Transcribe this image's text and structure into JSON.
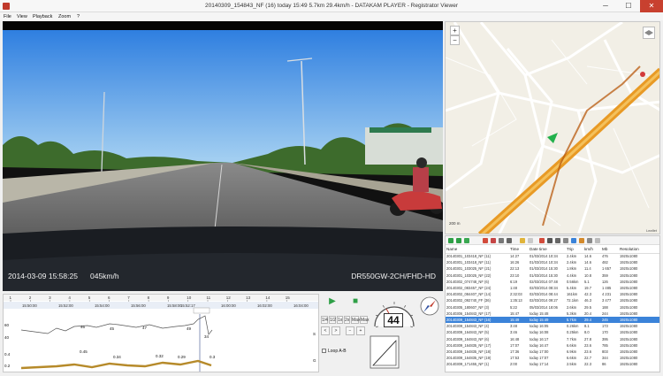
{
  "window": {
    "title": "20140309_154843_NF (16)   today 15:49   5.7km   29.4km/h  -  DATAKAM PLAYER - Registrator Viewer",
    "minimize": "─",
    "maximize": "☐",
    "close": "✕"
  },
  "menu": [
    "File",
    "View",
    "Playback",
    "Zoom",
    "?"
  ],
  "video": {
    "timestamp": "2014-03-09  15:58:25",
    "speed": "045km/h",
    "model": "DR550GW-2CH/FHD-HD"
  },
  "map": {
    "zoom_in": "+",
    "zoom_out": "−",
    "scale": "200 m",
    "attribution": "Leaflet"
  },
  "timeline": {
    "ruler_numbers": [
      "1",
      "2",
      "3",
      "4",
      "5",
      "6",
      "7",
      "8",
      "9",
      "10",
      "11",
      "12",
      "13",
      "14",
      "15"
    ],
    "time_labels": [
      "15:50:00",
      "15:52:00",
      "15:54:00",
      "15:56:00",
      "15:58:00",
      "15:52:17",
      "16:00:00",
      "16:02:00",
      "16:04:00"
    ],
    "speed_labels": [
      "46",
      "45",
      "47",
      "49",
      "34"
    ],
    "axis_top": [
      "60",
      "40"
    ],
    "axis_bottom": [
      "0.4",
      "0.2"
    ],
    "accel_labels": [
      "0.45",
      "0.34",
      "0.32",
      "0.29",
      "0.3"
    ],
    "side_labels": [
      "S",
      "G"
    ]
  },
  "controls": {
    "play": "▶",
    "stop": "■",
    "speeds": [
      "1/4",
      "1/2",
      "1x",
      "2x",
      "Max",
      "Max"
    ],
    "prev": "<",
    "next": ">",
    "zoom_minus": "−",
    "zoom_plus": "+",
    "loop_label": "Loop A-B",
    "speed_value": "44",
    "gauge_ticks": [
      "0",
      "20",
      "40",
      "60",
      "80",
      "100",
      "120"
    ]
  },
  "filelist": {
    "columns": [
      "Name",
      "Time",
      "Date time",
      "Trip",
      "km/h",
      "Mb",
      "Resolution"
    ],
    "rows": [
      [
        "20140301_103418_NF (11)",
        "14:27",
        "01/03/2014 10:34",
        "2.4km",
        "14.6",
        "476",
        "1920x1080"
      ],
      [
        "20140301_103418_NF (11)",
        "16:26",
        "01/03/2014 10:34",
        "2.4km",
        "14.6",
        "482",
        "1920x1080"
      ],
      [
        "20140301_103025_NF (21)",
        "22:13",
        "01/03/2014 15:30",
        "1.8km",
        "11.4",
        "1 657",
        "1920x1080"
      ],
      [
        "20140301_103025_NF (22)",
        "23:10",
        "01/03/2014 15:30",
        "4.4km",
        "10.8",
        "359",
        "1920x1080"
      ],
      [
        "20140302_074748_NF (6)",
        "6:19",
        "02/03/2014 07:48",
        "0.56km",
        "5.1",
        "126",
        "1920x1080"
      ],
      [
        "20140302_083457_NF (24)",
        "1:48",
        "02/03/2014 08:34",
        "5.4km",
        "19.7",
        "1 485",
        "1920x1080"
      ],
      [
        "20140302_084407_NF (14)",
        "2:32:03",
        "02/03/2014 08:44",
        "161km",
        "42.3",
        "4 231",
        "1920x1080"
      ],
      [
        "20140302_092740_FF (36)",
        "1:35:13",
        "02/03/2014 09:27",
        "72.1km",
        "46.3",
        "3 477",
        "1920x1080"
      ],
      [
        "20140305_180607_NF (3)",
        "5:22",
        "05/03/2014 18:06",
        "2.6km",
        "29.5",
        "188",
        "1920x1080"
      ],
      [
        "20140306_154843_NF (17)",
        "15:47",
        "today 15:48",
        "5.3km",
        "20.4",
        "244",
        "1920x1080"
      ],
      [
        "20140309_154843_NF (16)",
        "15:49",
        "today 15:49",
        "5.7km",
        "29.4",
        "245",
        "1920x1080"
      ],
      [
        "20140309_154843_NF (4)",
        "3:48",
        "today 16:05",
        "0.26km",
        "8.1",
        "173",
        "1920x1080"
      ],
      [
        "20140309_164843_NF (5)",
        "3:46",
        "today 16:08",
        "0.25km",
        "8.0",
        "170",
        "1920x1080"
      ],
      [
        "20140309_164843_NF (6)",
        "16:48",
        "today 16:17",
        "7.7km",
        "27.8",
        "395",
        "1920x1080"
      ],
      [
        "20140309_164835_NF (17)",
        "17:07",
        "today 16:47",
        "6.6km",
        "23.6",
        "785",
        "1920x1080"
      ],
      [
        "20140309_164835_NF (18)",
        "17:36",
        "today 17:00",
        "6.9km",
        "23.6",
        "803",
        "1920x1080"
      ],
      [
        "20140309_164835_NF (19)",
        "17:53",
        "today 17:07",
        "6.6km",
        "22.7",
        "344",
        "1920x1080"
      ],
      [
        "20140309_171455_NF (1)",
        "2:00",
        "today 17:14",
        "2.5km",
        "22.3",
        "86",
        "1920x1080"
      ]
    ],
    "selected_index": 10
  },
  "colors": {
    "accent": "#3b83d9",
    "route": "#e3a31b",
    "close": "#c8402f"
  }
}
